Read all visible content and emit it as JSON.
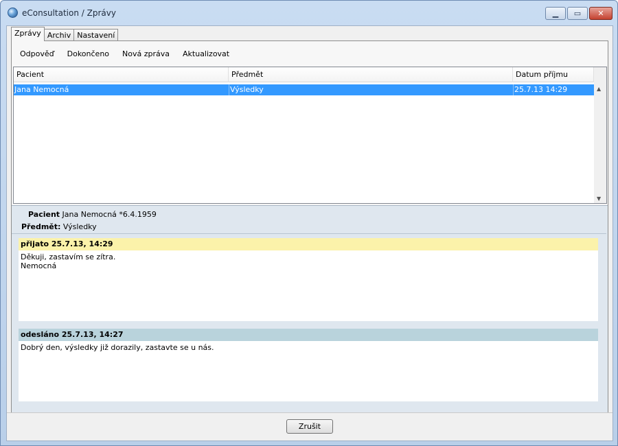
{
  "window": {
    "title": "eConsultation / Zprávy"
  },
  "tabs": [
    {
      "label": "Zprávy"
    },
    {
      "label": "Archiv"
    },
    {
      "label": "Nastavení"
    }
  ],
  "toolbar": [
    {
      "label": "Odpověď"
    },
    {
      "label": "Dokončeno"
    },
    {
      "label": "Nová zpráva"
    },
    {
      "label": "Aktualizovat"
    }
  ],
  "table": {
    "columns": [
      "Pacient",
      "Předmět",
      "Datum příjmu"
    ],
    "rows": [
      {
        "pacient": "Jana Nemocná",
        "predmet": "Výsledky",
        "datum": "25.7.13 14:29",
        "selected": true
      }
    ]
  },
  "detail": {
    "patient_label": "Pacient",
    "patient_value": "Jana Nemocná *6.4.1959",
    "subject_label": "Předmět:",
    "subject_value": "Výsledky"
  },
  "messages": [
    {
      "header": "přijato 25.7.13, 14:29",
      "body": "Děkuji, zastavím se zítra.\nNemocná",
      "color": "#fbf2aa"
    },
    {
      "header": "odesláno 25.7.13, 14:27",
      "body": "Dobrý den, výsledky již dorazily, zastavte se u nás.",
      "color": "#b9d3dc"
    }
  ],
  "footer": {
    "cancel_label": "Zrušit"
  },
  "icons": {
    "app": "app-globe-icon",
    "minimize": "minimize-icon",
    "maximize": "maximize-icon",
    "close": "close-icon",
    "scroll_up": "scroll-up-arrow-icon",
    "scroll_down": "scroll-down-arrow-icon"
  }
}
